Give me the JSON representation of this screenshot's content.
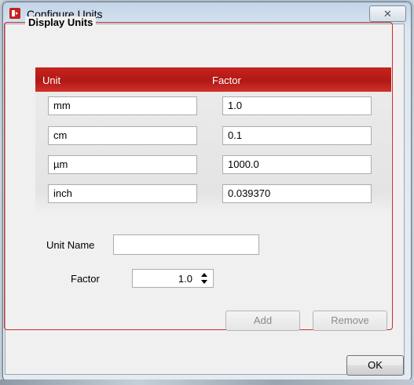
{
  "window": {
    "title": "Configure Units",
    "close_glyph": "✕",
    "app_icon": "units-app-icon"
  },
  "group": {
    "legend": "Display Units"
  },
  "table": {
    "headers": {
      "unit": "Unit",
      "factor": "Factor"
    },
    "rows": [
      {
        "unit": "mm",
        "factor": "1.0"
      },
      {
        "unit": "cm",
        "factor": "0.1"
      },
      {
        "unit": "µm",
        "factor": "1000.0"
      },
      {
        "unit": "inch",
        "factor": "0.039370"
      }
    ]
  },
  "form": {
    "unit_name_label": "Unit Name",
    "unit_name_value": "",
    "factor_label": "Factor",
    "factor_value": "1.0"
  },
  "buttons": {
    "add": "Add",
    "remove": "Remove",
    "ok": "OK"
  },
  "colors": {
    "accent_red": "#b01915",
    "frame_red": "#d22a24"
  }
}
